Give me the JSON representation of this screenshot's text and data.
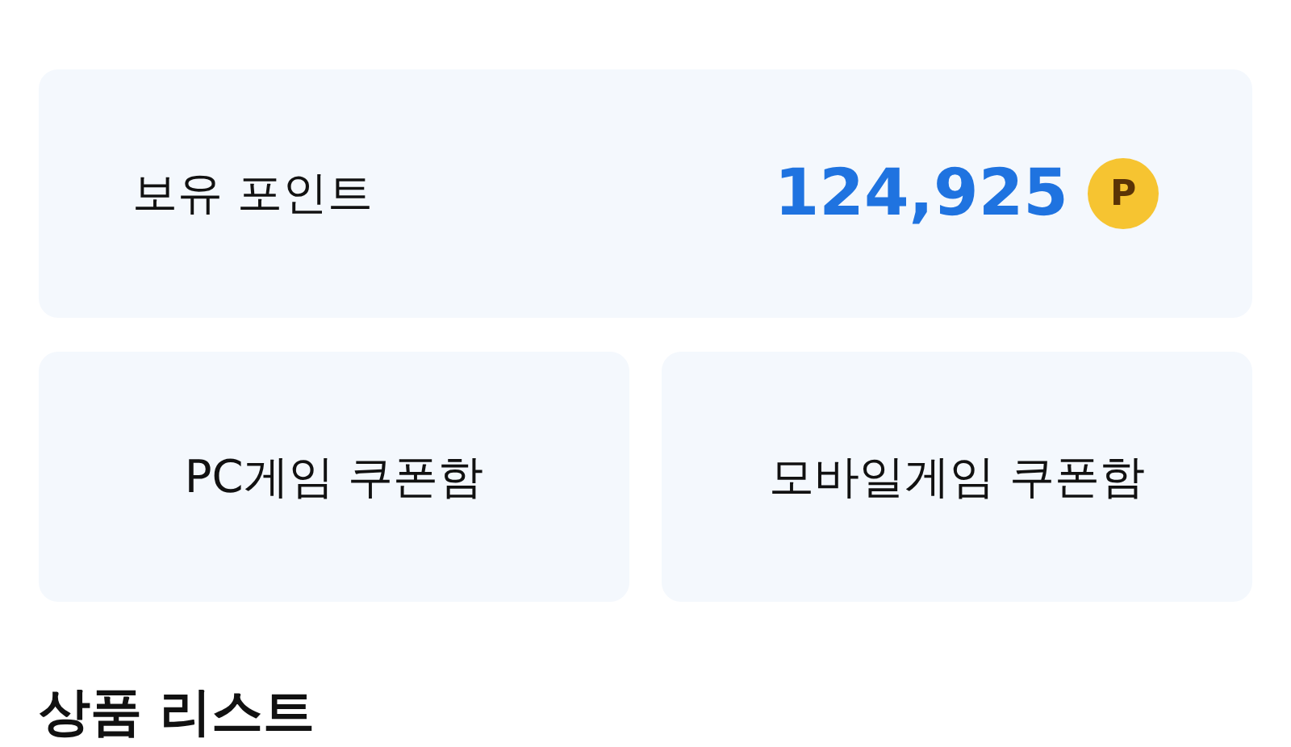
{
  "points": {
    "label": "보유 포인트",
    "value": "124,925",
    "coin_label": "P"
  },
  "coupon_boxes": [
    {
      "label": "PC게임 쿠폰함"
    },
    {
      "label": "모바일게임 쿠폰함"
    }
  ],
  "section_title": "상품 리스트"
}
